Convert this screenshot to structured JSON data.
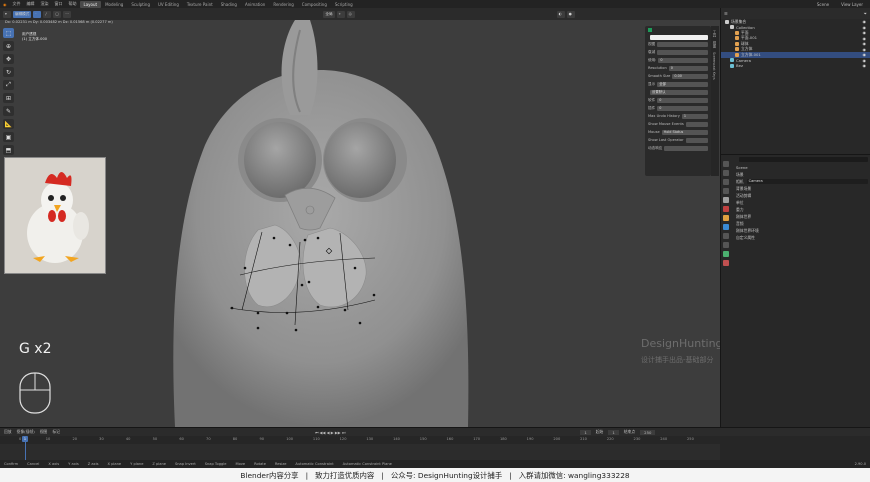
{
  "topbar": {
    "menus": [
      "文件",
      "编辑",
      "渲染",
      "窗口",
      "帮助"
    ],
    "workspaces": [
      "Layout",
      "Modeling",
      "Sculpting",
      "UV Editing",
      "Texture Paint",
      "Shading",
      "Animation",
      "Rendering",
      "Compositing",
      "Scripting"
    ],
    "active_workspace": "Layout",
    "scene_label": "Scene",
    "view_layer_label": "View Layer"
  },
  "viewport_header": {
    "mode_label": "编辑模式",
    "transform_label": "全局"
  },
  "viewport_info": "Dx: 0.02231 m   Dy: 0.003482 m   Dz: 0.01568 m (0.02277 m)",
  "overlay": {
    "line1": "用户透视",
    "line2": "(1) 立方体.000"
  },
  "overlay_key": "G x2",
  "watermark": {
    "brand": "DesignHunting",
    "subtitle": "设计捕手出品-基础部分"
  },
  "redo_panel": {
    "rows": [
      {
        "label": "视图",
        "value": ""
      },
      {
        "label": "衰减",
        "value": ""
      },
      {
        "label": "使用:",
        "value": "0"
      },
      {
        "label": "Resolution",
        "value": "0"
      },
      {
        "label": "Smooth Size",
        "value": "0.00"
      },
      {
        "label": "显示",
        "value": "全部"
      },
      {
        "label": "",
        "value": "设置默认"
      },
      {
        "label": "软件",
        "value": "0"
      },
      {
        "label": "插件",
        "value": "0"
      },
      {
        "label": "Max Undo History",
        "value": "1"
      },
      {
        "label": "Show Mouse Events",
        "value": ""
      },
      {
        "label": "Mouse",
        "value": "Hold Status"
      },
      {
        "label": "Show Last Operator",
        "value": ""
      },
      {
        "label": "动态响应",
        "value": ""
      }
    ],
    "side_tabs": [
      "工具",
      "视图",
      "Screencast Keys"
    ]
  },
  "outliner": {
    "search_placeholder": "",
    "rows": [
      {
        "label": "场景集合",
        "indent": 0,
        "color": "#cccccc",
        "selected": false
      },
      {
        "label": "Collection",
        "indent": 1,
        "color": "#cccccc",
        "selected": false
      },
      {
        "label": "平面",
        "indent": 2,
        "color": "#e3a150",
        "selected": false
      },
      {
        "label": "平面.001",
        "indent": 2,
        "color": "#e3a150",
        "selected": false
      },
      {
        "label": "球体",
        "indent": 2,
        "color": "#e3a150",
        "selected": false
      },
      {
        "label": "立方体",
        "indent": 2,
        "color": "#e3a150",
        "selected": false
      },
      {
        "label": "立方体.001",
        "indent": 2,
        "color": "#e3a150",
        "selected": true
      },
      {
        "label": "Camera",
        "indent": 1,
        "color": "#6cc0d4",
        "selected": false
      },
      {
        "label": "Bez",
        "indent": 1,
        "color": "#6cc0d4",
        "selected": false
      }
    ]
  },
  "properties": {
    "scene_label": "Scene",
    "rows": [
      {
        "label": "场景",
        "value": ""
      },
      {
        "label": "相机",
        "value": "Camera"
      },
      {
        "label": "背景场景",
        "value": ""
      },
      {
        "label": "活动剪辑",
        "value": ""
      },
      {
        "label": "单位",
        "value": ""
      },
      {
        "label": "重力",
        "value": ""
      },
      {
        "label": "刚体世界",
        "value": ""
      },
      {
        "label": "音频",
        "value": ""
      },
      {
        "label": "刚体世界环境",
        "value": ""
      },
      {
        "label": "自定义属性",
        "value": ""
      }
    ]
  },
  "timeline": {
    "menus": [
      "回放",
      "抠像(插帧)",
      "视图",
      "标记"
    ],
    "current_frame": "1",
    "start_label": "起始",
    "start": "1",
    "end_label": "结束点",
    "end": "250",
    "ruler_ticks": [
      "0",
      "10",
      "20",
      "30",
      "40",
      "50",
      "60",
      "70",
      "80",
      "90",
      "100",
      "110",
      "120",
      "130",
      "140",
      "150",
      "160",
      "170",
      "180",
      "190",
      "200",
      "210",
      "220",
      "230",
      "240",
      "250"
    ]
  },
  "statusbar": {
    "items": [
      "Confirm",
      "Cancel",
      "X axis",
      "Y axis",
      "Z axis",
      "X plane",
      "Y plane",
      "Z plane",
      "Snap Invert",
      "Snap Toggle",
      "Move",
      "Rotate",
      "Resize",
      "Automatic Constraint",
      "Automatic Constraint Plane"
    ],
    "version": "2.90.0"
  },
  "caption": "Blender内容分享   |   致力打造优质内容   |   公众号: DesignHunting设计捕手   |   入群请加微信: wangling333228"
}
